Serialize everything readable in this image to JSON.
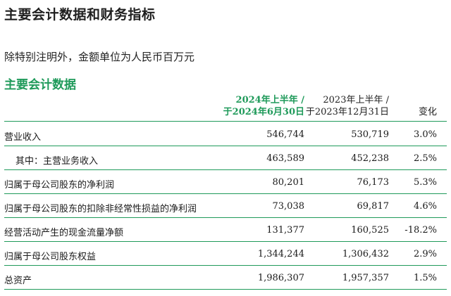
{
  "page_title": "主要会计数据和财务指标",
  "unit_note": "除特别注明外，金额单位为人民币百万元",
  "section_title": "主要会计数据",
  "columns": {
    "current_line1": "2024年上半年 /",
    "current_line2": "于2024年6月30日",
    "previous_line1": "2023年上半年 /",
    "previous_line2": "于2023年12月31日",
    "change": "变化"
  },
  "rows": [
    {
      "label": "营业收入",
      "current": "546,744",
      "previous": "530,719",
      "change": "3.0%"
    },
    {
      "label": "其中：主营业务收入",
      "current": "463,589",
      "previous": "452,238",
      "change": "2.5%"
    },
    {
      "label": "归属于母公司股东的净利润",
      "current": "80,201",
      "previous": "76,173",
      "change": "5.3%"
    },
    {
      "label": "归属于母公司股东的扣除非经常性损益的净利润",
      "current": "73,038",
      "previous": "69,817",
      "change": "4.6%"
    },
    {
      "label": "经营活动产生的现金流量净额",
      "current": "131,377",
      "previous": "160,525",
      "change": "-18.2%"
    },
    {
      "label": "归属于母公司股东权益",
      "current": "1,344,244",
      "previous": "1,306,432",
      "change": "2.9%"
    },
    {
      "label": "总资产",
      "current": "1,986,307",
      "previous": "1,957,357",
      "change": "1.5%"
    }
  ],
  "colors": {
    "accent": "#1f9a5a",
    "text": "#1a1a1a"
  }
}
